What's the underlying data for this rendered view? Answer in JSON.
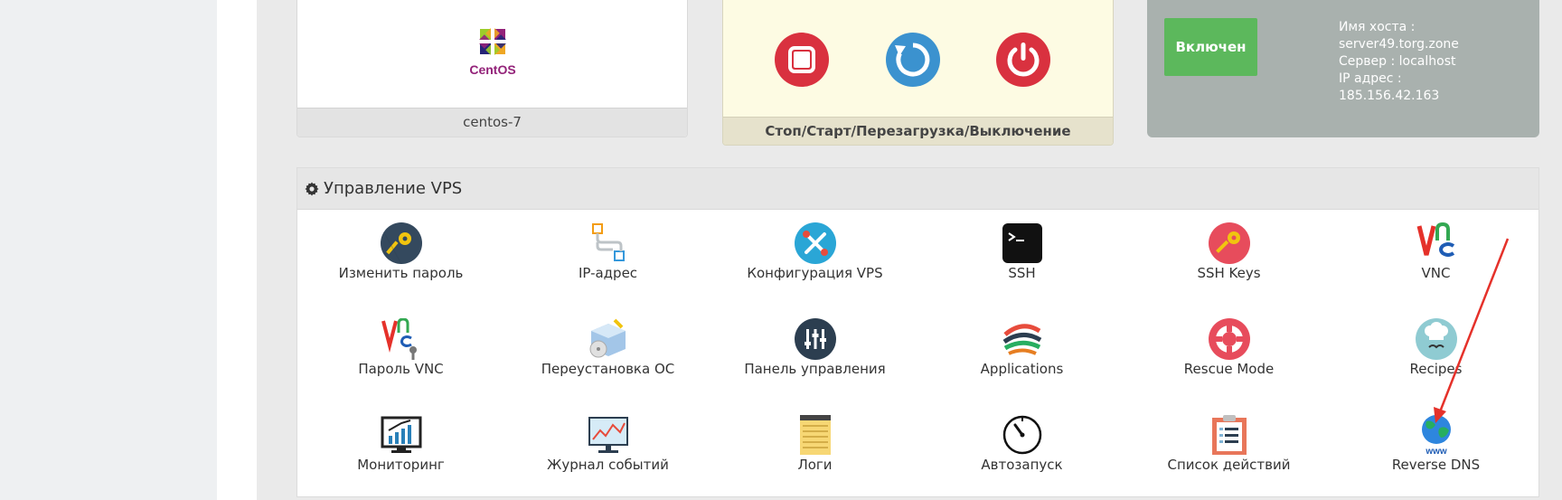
{
  "os": {
    "name": "centos-7",
    "logo_text": "CentOS"
  },
  "power": {
    "caption": "Стоп/Старт/Перезагрузка/Выключение",
    "colors": {
      "stop": "#d9313f",
      "start": "#3b92cf",
      "shutdown": "#d9313f"
    }
  },
  "status": {
    "badge": "Включен",
    "hostname_label": "Имя хоста :",
    "hostname": "server49.torg.zone",
    "server": "Сервер : localhost",
    "ip_label": "IP адрес :",
    "ip": "185.156.42.163",
    "badge_color": "#5cb85c"
  },
  "panel": {
    "title": "Управление VPS",
    "tiles": [
      {
        "label": "Изменить пароль",
        "icon": "key-icon"
      },
      {
        "label": "IP-адрес",
        "icon": "network-icon"
      },
      {
        "label": "Конфигурация VPS",
        "icon": "tools-icon"
      },
      {
        "label": "SSH",
        "icon": "terminal-icon"
      },
      {
        "label": "SSH Keys",
        "icon": "ssh-key-icon"
      },
      {
        "label": "VNC",
        "icon": "vnc-icon"
      },
      {
        "label": "Пароль VNC",
        "icon": "vnc-password-icon"
      },
      {
        "label": "Переустановка ОС",
        "icon": "reinstall-icon"
      },
      {
        "label": "Панель управления",
        "icon": "control-panel-icon"
      },
      {
        "label": "Applications",
        "icon": "applications-icon"
      },
      {
        "label": "Rescue Mode",
        "icon": "lifebuoy-icon"
      },
      {
        "label": "Recipes",
        "icon": "chef-icon"
      },
      {
        "label": "Мониторинг",
        "icon": "monitor-chart-icon"
      },
      {
        "label": "Журнал событий",
        "icon": "event-log-icon"
      },
      {
        "label": "Логи",
        "icon": "notepad-icon"
      },
      {
        "label": "Автозапуск",
        "icon": "gauge-icon"
      },
      {
        "label": "Список действий",
        "icon": "clipboard-list-icon"
      },
      {
        "label": "Reverse DNS",
        "icon": "globe-www-icon"
      }
    ]
  }
}
